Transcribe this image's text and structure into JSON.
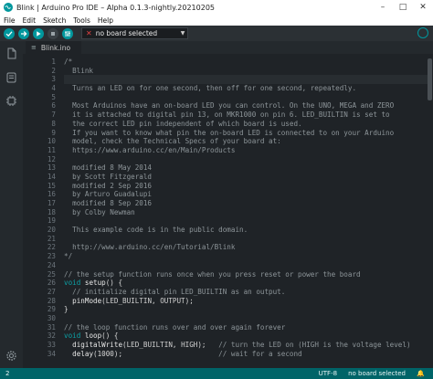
{
  "window": {
    "title": "Blink | Arduino Pro IDE – Alpha 0.1.3-nightly.20210205"
  },
  "menu": [
    "File",
    "Edit",
    "Sketch",
    "Tools",
    "Help"
  ],
  "toolbar": {
    "board_label": "no board selected"
  },
  "tab": {
    "label": "Blink.ino"
  },
  "code": {
    "current_line": 3,
    "lines": [
      {
        "n": "1",
        "t": "/*"
      },
      {
        "n": "2",
        "t": "  Blink"
      },
      {
        "n": "3",
        "t": ""
      },
      {
        "n": "4",
        "t": "  Turns an LED on for one second, then off for one second, repeatedly."
      },
      {
        "n": "5",
        "t": ""
      },
      {
        "n": "6",
        "t": "  Most Arduinos have an on-board LED you can control. On the UNO, MEGA and ZERO"
      },
      {
        "n": "7",
        "t": "  it is attached to digital pin 13, on MKR1000 on pin 6. LED_BUILTIN is set to"
      },
      {
        "n": "8",
        "t": "  the correct LED pin independent of which board is used."
      },
      {
        "n": "9",
        "t": "  If you want to know what pin the on-board LED is connected to on your Arduino"
      },
      {
        "n": "10",
        "t": "  model, check the Technical Specs of your board at:"
      },
      {
        "n": "11",
        "t": "  https://www.arduino.cc/en/Main/Products"
      },
      {
        "n": "12",
        "t": ""
      },
      {
        "n": "13",
        "t": "  modified 8 May 2014"
      },
      {
        "n": "14",
        "t": "  by Scott Fitzgerald"
      },
      {
        "n": "15",
        "t": "  modified 2 Sep 2016"
      },
      {
        "n": "16",
        "t": "  by Arturo Guadalupi"
      },
      {
        "n": "17",
        "t": "  modified 8 Sep 2016"
      },
      {
        "n": "18",
        "t": "  by Colby Newman"
      },
      {
        "n": "19",
        "t": ""
      },
      {
        "n": "20",
        "t": "  This example code is in the public domain."
      },
      {
        "n": "21",
        "t": ""
      },
      {
        "n": "22",
        "t": "  http://www.arduino.cc/en/Tutorial/Blink"
      },
      {
        "n": "23",
        "t": "*/"
      },
      {
        "n": "24",
        "t": ""
      },
      {
        "n": "25",
        "t": "// the setup function runs once when you press reset or power the board"
      },
      {
        "n": "26",
        "t": "void setup() {"
      },
      {
        "n": "27",
        "t": "  // initialize digital pin LED_BUILTIN as an output."
      },
      {
        "n": "28",
        "t": "  pinMode(LED_BUILTIN, OUTPUT);"
      },
      {
        "n": "29",
        "t": "}"
      },
      {
        "n": "30",
        "t": ""
      },
      {
        "n": "31",
        "t": "// the loop function runs over and over again forever"
      },
      {
        "n": "32",
        "t": "void loop() {"
      },
      {
        "n": "33",
        "t": "  digitalWrite(LED_BUILTIN, HIGH);   // turn the LED on (HIGH is the voltage level)"
      },
      {
        "n": "34",
        "t": "  delay(1000);                       // wait for a second"
      }
    ]
  },
  "status": {
    "left": "2",
    "encoding": "UTF-8",
    "board": "no board selected"
  },
  "colors": {
    "accent": "#00979d",
    "statusbar": "#006468",
    "keyword": "#0ca1a6",
    "function": "#e8e8e8",
    "comment": "#8d9599"
  }
}
